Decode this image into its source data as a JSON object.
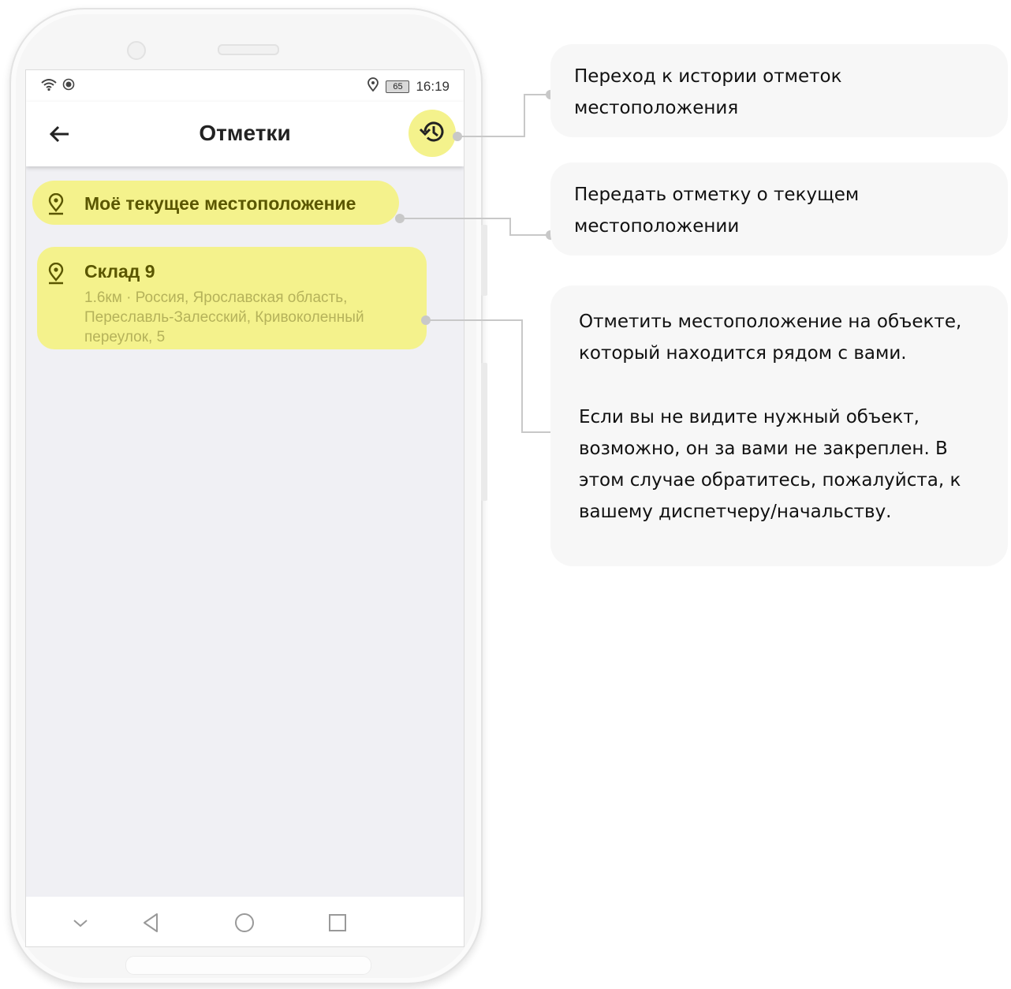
{
  "status_bar": {
    "battery": "65",
    "time": "16:19"
  },
  "app_bar": {
    "title": "Отметки"
  },
  "current_location": {
    "label": "Моё текущее местоположение"
  },
  "objects": [
    {
      "name": "Склад 9",
      "address": "1.6км · Россия, Ярославская область, Переславль-Залесский, Кривоколенный переулок, 5"
    }
  ],
  "annotations": {
    "history": "Переход к истории отметок местоположения",
    "current": "Передать отметку о текущем местоположении",
    "object_p1": "Отметить местоположение на объекте, который находится рядом с вами.",
    "object_p2": "Если вы не видите нужный объект, возможно, он за вами не закреплен. В этом случае обратитесь, пожалуйста, к вашему диспетчеру/начальству."
  },
  "colors": {
    "highlight": "#f4f28c",
    "highlight_text": "#5a5600",
    "address_text": "#b5b25a",
    "screen_bg": "#f0f0f4",
    "callout_bg": "#f7f7f7",
    "connector": "#c8c8c8"
  },
  "icons": [
    "wifi-icon",
    "record-icon",
    "location-status-icon",
    "back-arrow-icon",
    "history-icon",
    "location-pin-icon",
    "nav-down-icon",
    "nav-back-icon",
    "nav-home-icon",
    "nav-recents-icon"
  ]
}
